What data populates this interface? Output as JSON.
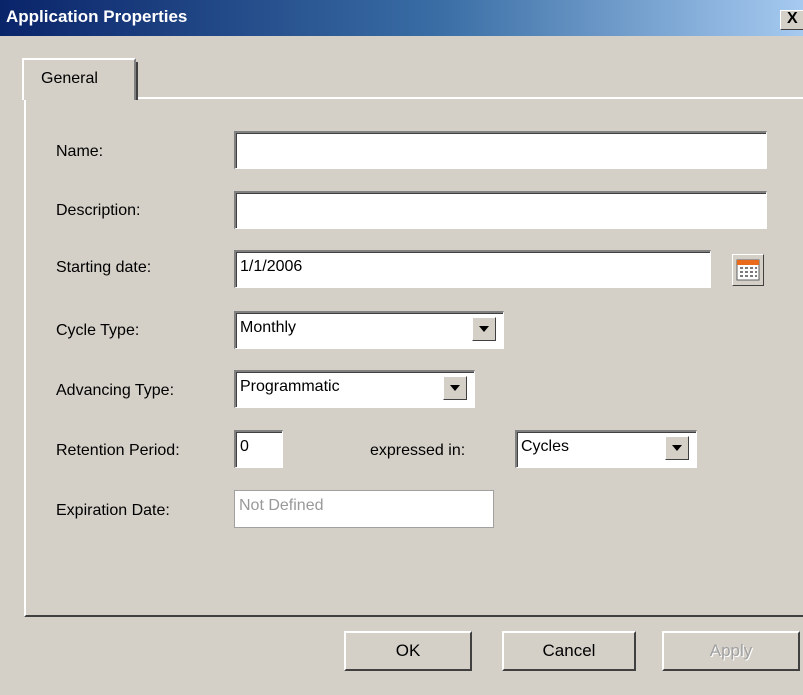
{
  "window": {
    "title": "Application Properties",
    "close_label": "X"
  },
  "tabs": [
    {
      "label": "General",
      "selected": true
    }
  ],
  "form": {
    "name": {
      "label": "Name:",
      "value": ""
    },
    "description": {
      "label": "Description:",
      "value": ""
    },
    "starting_date": {
      "label": "Starting date:",
      "value": "1/1/2006",
      "calendar_icon": "calendar-icon"
    },
    "cycle_type": {
      "label": "Cycle Type:",
      "value": "Monthly"
    },
    "advancing_type": {
      "label": "Advancing Type:",
      "value": "Programmatic"
    },
    "retention_period": {
      "label": "Retention Period:",
      "value": "0"
    },
    "expressed_in": {
      "label": "expressed in:",
      "value": "Cycles"
    },
    "expiration_date": {
      "label": "Expiration Date:",
      "placeholder": "Not Defined",
      "disabled": true
    }
  },
  "buttons": {
    "ok": {
      "label": "OK"
    },
    "cancel": {
      "label": "Cancel"
    },
    "apply": {
      "label": "Apply",
      "disabled": true
    }
  },
  "colors": {
    "title_gradient_start": "#0a246a",
    "title_gradient_end": "#a6caf0",
    "face": "#d4d0c8",
    "calendar_accent": "#e86a1a"
  }
}
